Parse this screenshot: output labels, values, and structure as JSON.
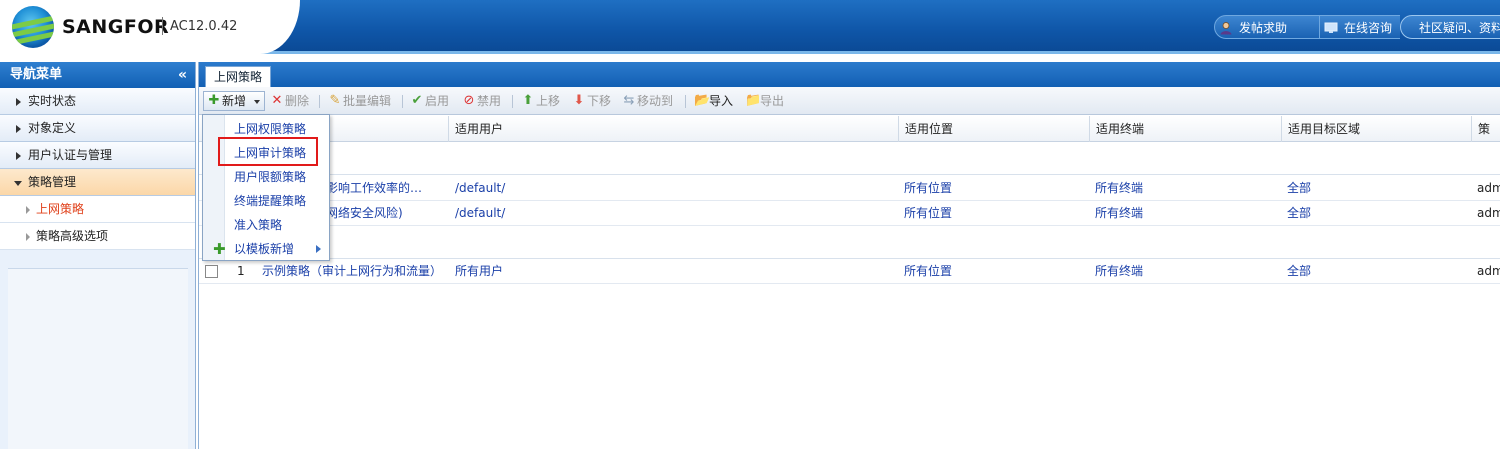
{
  "header": {
    "brand": "SANGFOR",
    "version": "AC12.0.42",
    "buttons": [
      {
        "label": "发帖求助",
        "icon": "user-icon"
      },
      {
        "label": "在线咨询",
        "icon": "monitor-icon"
      },
      {
        "label": "社区疑问、资料",
        "icon": ""
      }
    ]
  },
  "sidebar": {
    "title": "导航菜单",
    "collapse_glyph": "«",
    "groups": [
      {
        "label": "实时状态",
        "open": false
      },
      {
        "label": "对象定义",
        "open": false
      },
      {
        "label": "用户认证与管理",
        "open": false
      },
      {
        "label": "策略管理",
        "open": true
      }
    ],
    "sub_items": [
      {
        "label": "上网策略",
        "active": true
      },
      {
        "label": "策略高级选项",
        "active": false
      }
    ]
  },
  "tab": {
    "label": "上网策略"
  },
  "toolbar": {
    "new": "新增",
    "delete": "删除",
    "batch_edit": "批量编辑",
    "enable": "启用",
    "disable": "禁用",
    "move_up": "上移",
    "move_down": "下移",
    "move_to": "移动到",
    "import": "导入",
    "export": "导出"
  },
  "table": {
    "headers": [
      "适用用户",
      "适用位置",
      "适用终端",
      "适用目标区域",
      "策略"
    ],
    "rows": [
      {
        "name": "制影响工作效率的…",
        "users": "/default/",
        "location": "所有位置",
        "terminal": "所有终端",
        "zone": "全部",
        "owner": "adm"
      },
      {
        "name": "低网络安全风险)",
        "users": "/default/",
        "location": "所有位置",
        "terminal": "所有终端",
        "zone": "全部",
        "owner": "adm"
      },
      {
        "num": "1",
        "name": "示例策略（审计上网行为和流量）",
        "users": "所有用户",
        "location": "所有位置",
        "terminal": "所有终端",
        "zone": "全部",
        "owner": "adm"
      }
    ]
  },
  "dropdown": {
    "items": [
      {
        "label": "上网权限策略"
      },
      {
        "label": "上网审计策略"
      },
      {
        "label": "用户限额策略"
      },
      {
        "label": "终端提醒策略"
      },
      {
        "label": "准入策略"
      },
      {
        "label": "以模板新增"
      }
    ]
  },
  "colors": {
    "header_blue": "#1160b4",
    "active_menu": "#e0401a",
    "link_blue": "#1a3fa8",
    "highlight_red": "#e11a1a"
  }
}
